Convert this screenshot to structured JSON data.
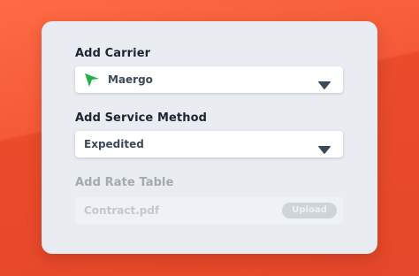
{
  "form": {
    "carrier": {
      "label": "Add Carrier",
      "selected": "Maergo",
      "logo_icon": "maergo-logo-icon",
      "caret_icon": "chevron-down-icon"
    },
    "service": {
      "label": "Add Service Method",
      "selected": "Expedited",
      "caret_icon": "chevron-down-icon"
    },
    "rate_table": {
      "label": "Add Rate Table",
      "placeholder": "Contract.pdf",
      "button_label": "Upload",
      "disabled": true
    }
  },
  "colors": {
    "background": "#e8492a",
    "card": "#e9edf2",
    "logo_green": "#22b14c",
    "caret": "#3c4a58"
  }
}
